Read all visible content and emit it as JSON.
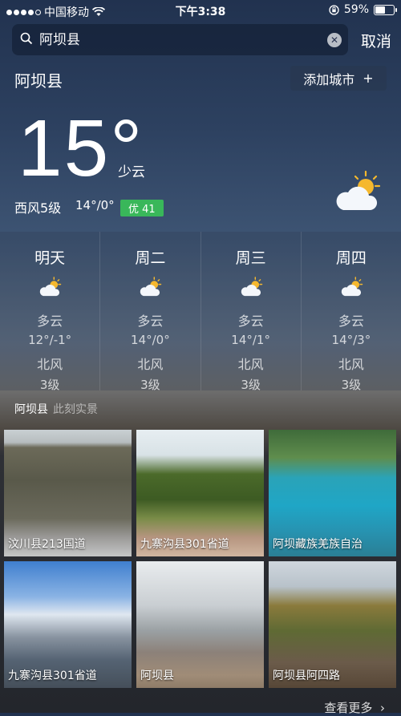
{
  "status_bar": {
    "carrier": "中国移动",
    "time": "下午3:38",
    "battery_percent": "59%",
    "battery_level": 0.59
  },
  "search": {
    "value": "阿坝县",
    "cancel_label": "取消"
  },
  "city": {
    "name": "阿坝县",
    "add_city_label": "添加城市",
    "add_icon": "+"
  },
  "current": {
    "temperature": "15°",
    "condition": "少云",
    "wind": "西风5级",
    "range": "14°/0°",
    "aqi": "优 41"
  },
  "forecast": [
    {
      "day": "明天",
      "condition": "多云",
      "temp": "12°/-1°",
      "wind": "北风",
      "level": "3级"
    },
    {
      "day": "周二",
      "condition": "多云",
      "temp": "14°/0°",
      "wind": "北风",
      "level": "3级"
    },
    {
      "day": "周三",
      "condition": "多云",
      "temp": "14°/1°",
      "wind": "北风",
      "level": "3级"
    },
    {
      "day": "周四",
      "condition": "多云",
      "temp": "14°/3°",
      "wind": "北风",
      "level": "3级"
    }
  ],
  "photos": {
    "city": "阿坝县",
    "subtitle": "此刻实景",
    "items": [
      {
        "caption": "汶川县213国道"
      },
      {
        "caption": "九寨沟县301省道"
      },
      {
        "caption": "阿坝藏族羌族自治"
      },
      {
        "caption": "九寨沟县301省道"
      },
      {
        "caption": "阿坝县"
      },
      {
        "caption": "阿坝县阿四路"
      }
    ],
    "more_label": "查看更多"
  },
  "colors": {
    "aqi_green": "#39b75a",
    "sun": "#f5b82e"
  }
}
